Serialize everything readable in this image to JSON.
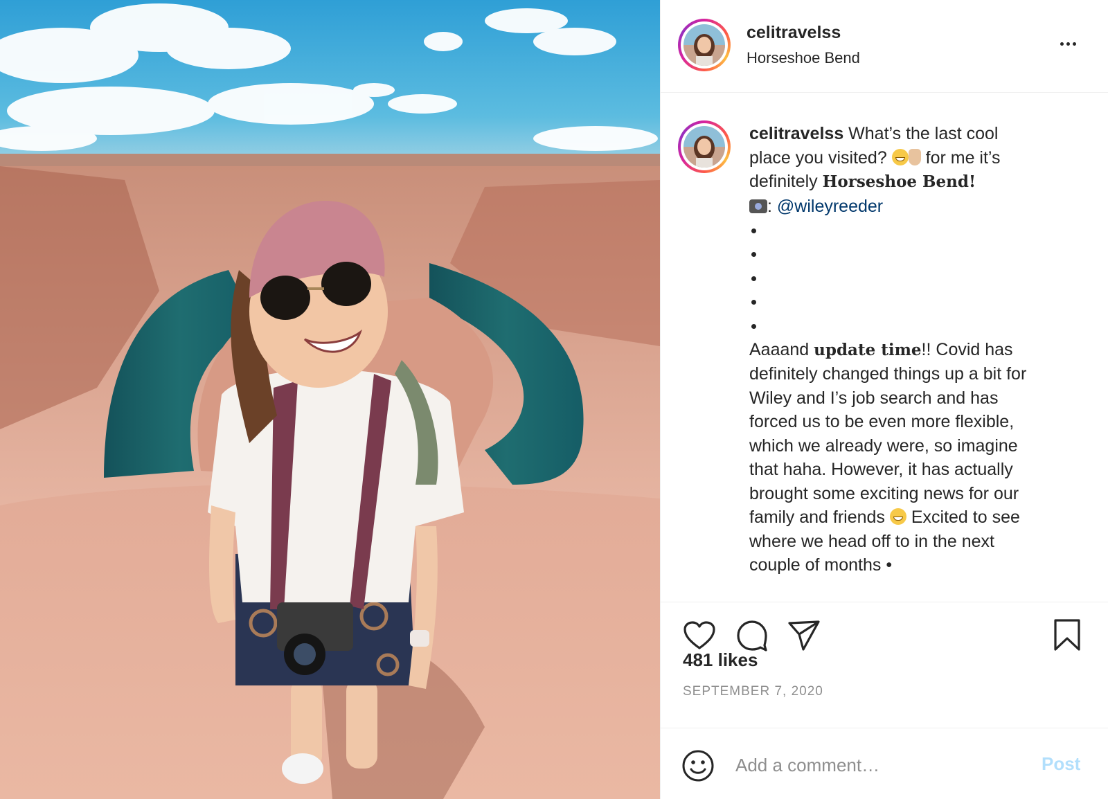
{
  "post": {
    "username": "celitravelss",
    "location": "Horseshoe Bend"
  },
  "caption": {
    "username": "celitravelss",
    "line1_text": "What’s the last cool",
    "line2a": "place you visited?",
    "line2b": "for me it’s",
    "line3a": "definitely",
    "line3_bold": "Horseshoe Bend",
    "line3c": "!",
    "line4_sep": ":",
    "mention": "@wileyreeder",
    "para2_start": "Aaaand",
    "para2_bold": "update time",
    "para2_rest": "!! Covid has",
    "lines": [
      "definitely changed things up a bit for",
      "Wiley and I’s job search and has",
      "forced us to be even more flexible,",
      "which we already were, so imagine",
      "that haha. However, it has actually",
      "brought some exciting news for our"
    ],
    "line_family_a": "family and friends",
    "line_family_b": "Excited to see",
    "line_last1": "where we head off to in the next",
    "line_last2": "couple of months •"
  },
  "stats": {
    "likes": "481 likes",
    "date": "SEPTEMBER 7, 2020"
  },
  "comment": {
    "placeholder": "Add a comment…",
    "post_label": "Post",
    "post_color": "#b2dffc"
  },
  "icons": {
    "like": "heart-icon",
    "comment": "speech-bubble-icon",
    "share": "paper-plane-icon",
    "save": "bookmark-icon",
    "more": "more-options-icon",
    "emoji": "smiley-icon"
  }
}
